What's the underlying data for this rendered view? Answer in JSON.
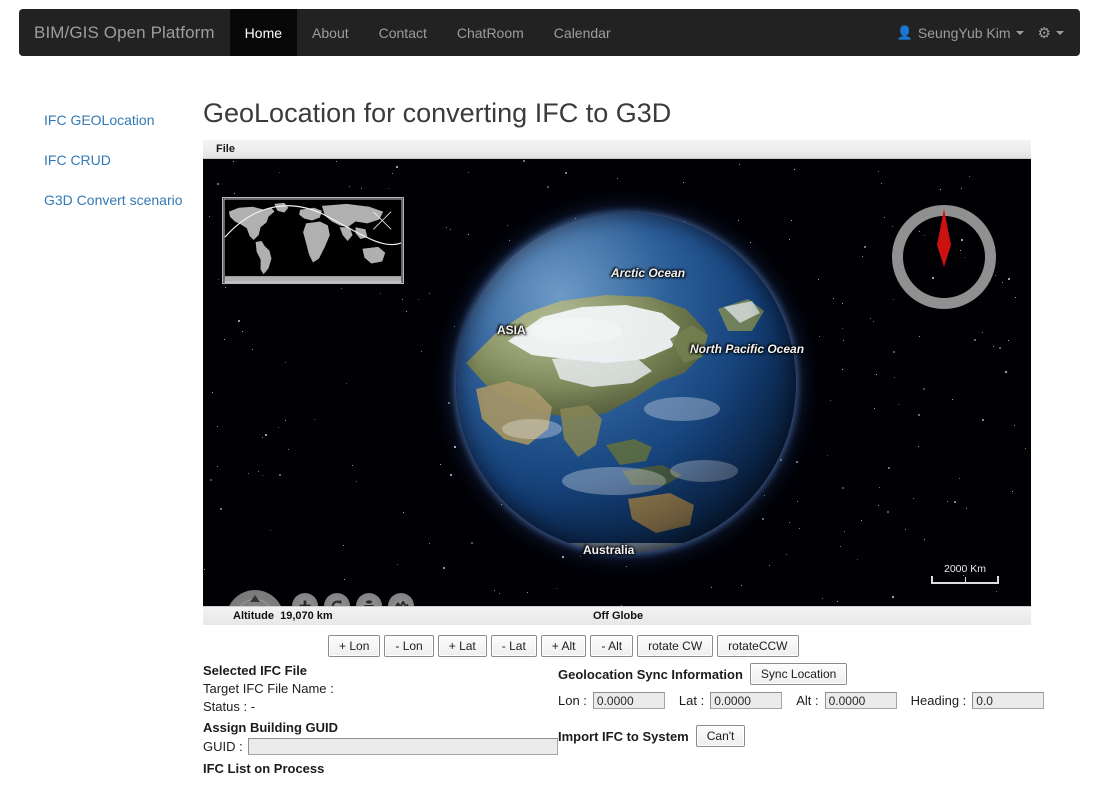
{
  "navbar": {
    "brand": "BIM/GIS Open Platform",
    "items": [
      {
        "label": "Home",
        "active": true
      },
      {
        "label": "About",
        "active": false
      },
      {
        "label": "Contact",
        "active": false
      },
      {
        "label": "ChatRoom",
        "active": false
      },
      {
        "label": "Calendar",
        "active": false
      }
    ],
    "user": "SeungYub Kim",
    "user_icon": "user-icon",
    "gear_icon": "gear-icon",
    "background": "#222222",
    "active_background": "#080808",
    "link_color": "#9d9d9d"
  },
  "sidebar": {
    "items": [
      {
        "label": "IFC GEOLocation"
      },
      {
        "label": "IFC CRUD"
      },
      {
        "label": "G3D Convert scenario"
      }
    ],
    "link_color": "#337ab7"
  },
  "main": {
    "title": "GeoLocation for converting IFC to G3D"
  },
  "applet": {
    "menubar": {
      "file_label": "File"
    },
    "globe": {
      "labels": [
        {
          "text": "Arctic Ocean",
          "style": "italic"
        },
        {
          "text": "ASIA",
          "style": "plain"
        },
        {
          "text": "North Pacific Ocean",
          "style": "italic"
        },
        {
          "text": "Australia",
          "style": "plain"
        }
      ],
      "scalebar": "2000 Km",
      "compass_needle_color": "#cc1111",
      "controls": [
        {
          "name": "pan-control",
          "glyph": "+"
        },
        {
          "name": "zoom-in-button",
          "glyph": "+"
        },
        {
          "name": "rotate-ccw-button",
          "glyph": "↺"
        },
        {
          "name": "tilt-button",
          "glyph": "≡"
        },
        {
          "name": "terrain-profile-button",
          "glyph": "∿"
        },
        {
          "name": "zoom-out-button",
          "glyph": "−"
        },
        {
          "name": "rotate-cw-button",
          "glyph": "↻"
        },
        {
          "name": "vertical-exaggeration-button",
          "glyph": "█"
        },
        {
          "name": "horizon-button",
          "glyph": "≈"
        }
      ]
    },
    "statusbar": {
      "altitude_label": "Altitude",
      "altitude_value": "19,070 km",
      "globe_status": "Off Globe"
    },
    "buttons": [
      {
        "label": "+ Lon",
        "name": "lon-plus-button"
      },
      {
        "label": "- Lon",
        "name": "lon-minus-button"
      },
      {
        "label": "+ Lat",
        "name": "lat-plus-button"
      },
      {
        "label": "- Lat",
        "name": "lat-minus-button"
      },
      {
        "label": "+ Alt",
        "name": "alt-plus-button"
      },
      {
        "label": "- Alt",
        "name": "alt-minus-button"
      },
      {
        "label": "rotate CW",
        "name": "rotate-cw-button"
      },
      {
        "label": "rotateCCW",
        "name": "rotate-ccw-button"
      }
    ]
  },
  "form": {
    "left": {
      "selected_file_header": "Selected IFC File",
      "target_file_label": "Target IFC File Name :",
      "status_label": "Status : -",
      "guid_header": "Assign Building GUID",
      "guid_label": "GUID :",
      "guid_value": "",
      "guid_placeholder": "",
      "list_header": "IFC List on Process"
    },
    "right": {
      "sync_header": "Geolocation Sync Information",
      "sync_button": "Sync Location",
      "lon_label": "Lon :",
      "lon_value": "0.0000",
      "lat_label": "Lat :",
      "lat_value": "0.0000",
      "alt_label": "Alt :",
      "alt_value": "0.0000",
      "heading_label": "Heading :",
      "heading_value": "0.0",
      "import_header": "Import IFC to System",
      "import_button": "Can't"
    }
  }
}
